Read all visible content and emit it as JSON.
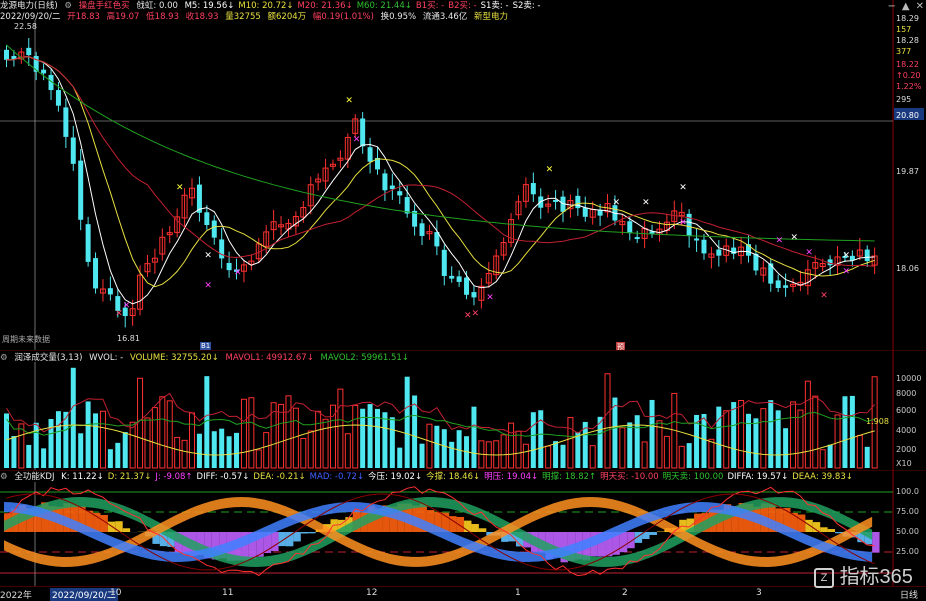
{
  "main": {
    "title": "龙源电力(日线)",
    "mode": "操盘手红色买",
    "qj": "戗虹: 0.00",
    "ma": [
      {
        "label": "M5: 19.56",
        "arrow": "↓",
        "color": "#ffffff"
      },
      {
        "label": "M10: 20.72",
        "arrow": "↓",
        "color": "#e8e040"
      },
      {
        "label": "M20: 21.36",
        "arrow": "↓",
        "color": "#ff4060"
      },
      {
        "label": "M60: 21.44",
        "arrow": "↓",
        "color": "#30c030"
      },
      {
        "label": "B1买: -",
        "arrow": "",
        "color": "#ff4060"
      },
      {
        "label": "B2买: -",
        "arrow": "",
        "color": "#ff4060"
      },
      {
        "label": "S1卖: -",
        "arrow": "",
        "color": "#ffffff"
      },
      {
        "label": "S2卖: -",
        "arrow": "",
        "color": "#ffffff"
      }
    ],
    "quote": {
      "date": "2022/09/20/二",
      "open": "开18.83",
      "high": "高19.07",
      "low": "低18.93",
      "close": "收18.93",
      "vol": "量32755",
      "amount": "额6204万",
      "change": "幅0.19(1.01%)",
      "turnover": "换0.95%",
      "float": "流通3.46亿",
      "sector": "新型电力"
    },
    "high_label": "22.58",
    "low_label": "16.81",
    "note": "周期未来数据",
    "mark_b1": "B1",
    "mark_yu": "预",
    "right_axis": [
      "18.29",
      "157",
      "18.28",
      "377",
      "18.22",
      "↑0.20",
      "1.22%",
      "295",
      "20.80",
      "19.87",
      "18.06"
    ],
    "tb_icons": [
      "minus-icon",
      "up-icon",
      "close-icon"
    ]
  },
  "volume": {
    "title": "润泽成交量(3,13)",
    "wvol": "WVOL: -",
    "volume": "VOLUME: 32755.20↓",
    "mavol1": "MAVOL1: 49912.67↓",
    "mavol2": "MAVOL2: 59961.51↓",
    "right_axis": [
      "10000",
      "8000",
      "6000",
      "4000",
      "2000",
      "X10"
    ],
    "marker": "1.908"
  },
  "kdj": {
    "title": "全功能KDJ",
    "items": [
      {
        "label": "K: 11.22↓",
        "color": "#ffffff"
      },
      {
        "label": "D: 21.37↓",
        "color": "#e8e040"
      },
      {
        "label": "J: -9.08↑",
        "color": "#ff40ff"
      },
      {
        "label": "DIFF: -0.57↓",
        "color": "#ffffff"
      },
      {
        "label": "DEA: -0.21↓",
        "color": "#e8e040"
      },
      {
        "label": "MAD: -0.72↓",
        "color": "#4060ff"
      },
      {
        "label": "今压: 19.02↓",
        "color": "#ffffff"
      },
      {
        "label": "今撑: 18.46↓",
        "color": "#e8e040"
      },
      {
        "label": "明压: 19.04↓",
        "color": "#ff40ff"
      },
      {
        "label": "明撑: 18.82↑",
        "color": "#30c030"
      },
      {
        "label": "明天买: -10.00",
        "color": "#ff4060"
      },
      {
        "label": "明天卖: 100.00",
        "color": "#30c030"
      },
      {
        "label": "DIFFA: 19.57↓",
        "color": "#ffffff"
      },
      {
        "label": "DEAA: 39.83↓",
        "color": "#e8e040"
      }
    ],
    "right_axis": [
      "100.0",
      "75.00",
      "50.00",
      "25.00"
    ]
  },
  "xaxis": {
    "labels": [
      "2022年",
      "2022/09/20/二",
      "10",
      "11",
      "12",
      "1",
      "2",
      "3"
    ],
    "period": "日线"
  },
  "watermark": "指标365"
}
